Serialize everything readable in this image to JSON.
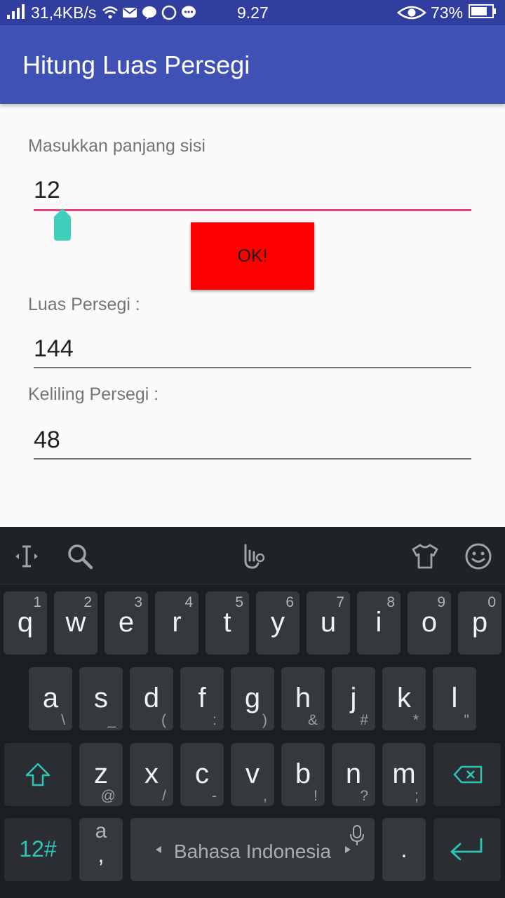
{
  "status_bar": {
    "network_speed": "31,4KB/s",
    "time": "9.27",
    "battery": "73%",
    "icons": [
      "signal-icon",
      "wifi-icon",
      "mail-icon",
      "line-icon",
      "whatsapp-icon",
      "chat-icon",
      "eye-icon",
      "battery-icon"
    ]
  },
  "app_bar": {
    "title": "Hitung Luas Persegi"
  },
  "form": {
    "side_label": "Masukkan panjang sisi",
    "side_value": "12",
    "ok_button": "OK!",
    "area_label": "Luas Persegi :",
    "area_value": "144",
    "perimeter_label": "Keliling Persegi :",
    "perimeter_value": "48"
  },
  "keyboard": {
    "toolbar_icons": [
      "text-cursor-icon",
      "search-icon",
      "gesture-icon",
      "theme-shirt-icon",
      "emoji-icon"
    ],
    "row1": [
      {
        "k": "q",
        "s": "1"
      },
      {
        "k": "w",
        "s": "2"
      },
      {
        "k": "e",
        "s": "3"
      },
      {
        "k": "r",
        "s": "4"
      },
      {
        "k": "t",
        "s": "5"
      },
      {
        "k": "y",
        "s": "6"
      },
      {
        "k": "u",
        "s": "7"
      },
      {
        "k": "i",
        "s": "8"
      },
      {
        "k": "o",
        "s": "9"
      },
      {
        "k": "p",
        "s": "0"
      }
    ],
    "row2": [
      {
        "k": "a",
        "s": "\\"
      },
      {
        "k": "s",
        "s": "_"
      },
      {
        "k": "d",
        "s": "("
      },
      {
        "k": "f",
        "s": ":"
      },
      {
        "k": "g",
        "s": ")"
      },
      {
        "k": "h",
        "s": "&"
      },
      {
        "k": "j",
        "s": "#"
      },
      {
        "k": "k",
        "s": "*"
      },
      {
        "k": "l",
        "s": "\""
      }
    ],
    "row3": [
      {
        "k": "z",
        "s": "@"
      },
      {
        "k": "x",
        "s": "/"
      },
      {
        "k": "c",
        "s": "-"
      },
      {
        "k": "v",
        "s": ","
      },
      {
        "k": "b",
        "s": "!"
      },
      {
        "k": "n",
        "s": "?"
      },
      {
        "k": "m",
        "s": ";"
      }
    ],
    "symbols_key": "12#",
    "comma_key_top": "a",
    "comma_key_bottom": ",",
    "space_label": "Bahasa Indonesia",
    "period_key": ".",
    "accent_color": "#2ec4b6"
  }
}
